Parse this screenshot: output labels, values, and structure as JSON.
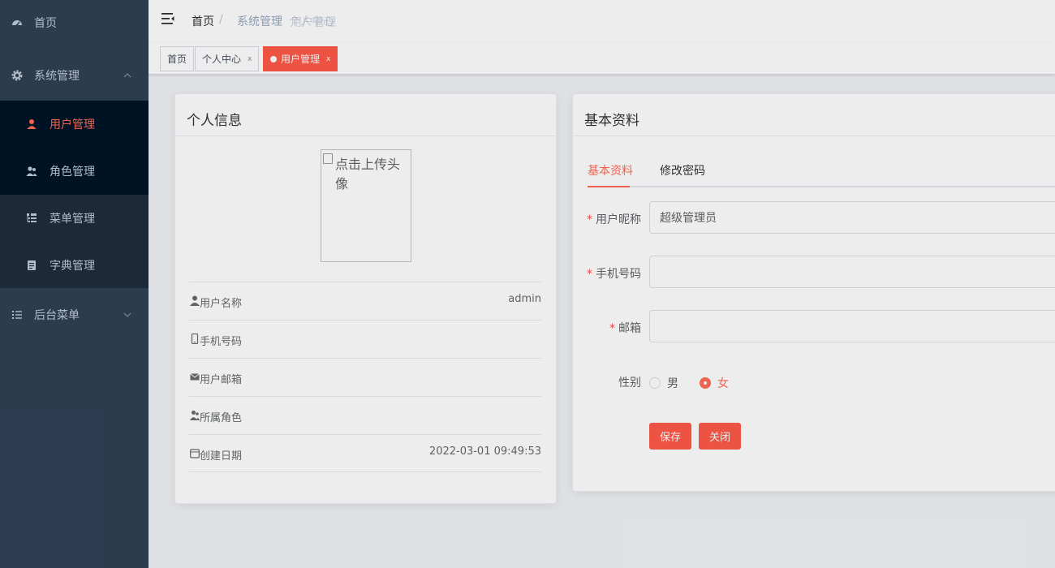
{
  "sidebar": {
    "items": [
      {
        "label": "首页",
        "icon": "dashboard-icon"
      },
      {
        "label": "系统管理",
        "icon": "gear-icon"
      },
      {
        "label": "后台菜单",
        "icon": "list-icon"
      }
    ],
    "sub_items": [
      {
        "label": "用户管理",
        "icon": "user-icon",
        "active": true
      },
      {
        "label": "角色管理",
        "icon": "peoples-icon"
      },
      {
        "label": "菜单管理",
        "icon": "tree-table-icon"
      },
      {
        "label": "字典管理",
        "icon": "dict-icon"
      }
    ]
  },
  "navbar": {
    "breadcrumb": [
      "首页",
      "系统管理",
      "个人中心",
      "用户管理"
    ],
    "separator": "/"
  },
  "tags": [
    {
      "label": "首页"
    },
    {
      "label": "个人中心",
      "close": "x"
    },
    {
      "label": "用户管理",
      "close": "x",
      "active": true
    }
  ],
  "profile": {
    "title": "个人信息",
    "avatar_text": "点击上传头像",
    "rows": [
      {
        "key": "用户名称",
        "value": "admin",
        "icon": "user-icon"
      },
      {
        "key": "手机号码",
        "value": "",
        "icon": "phone-icon"
      },
      {
        "key": "用户邮箱",
        "value": "",
        "icon": "email-icon"
      },
      {
        "key": "所属角色",
        "value": "",
        "icon": "peoples-icon"
      },
      {
        "key": "创建日期",
        "value": "2022-03-01 09:49:53",
        "icon": "date-icon"
      }
    ]
  },
  "basic": {
    "title": "基本资料",
    "tabs": [
      "基本资料",
      "修改密码"
    ],
    "fields": [
      {
        "label": "用户昵称",
        "value": "超级管理员",
        "required": true
      },
      {
        "label": "手机号码",
        "value": "",
        "required": true
      },
      {
        "label": "邮箱",
        "value": "",
        "required": true
      }
    ],
    "gender_label": "性别",
    "gender_options": [
      "男",
      "女"
    ],
    "gender_selected": "女",
    "save_label": "保存",
    "close_label": "关闭"
  },
  "colors": {
    "sidebar_bg": "#304156",
    "submenu_bg": "#1f2d3d",
    "accent": "#ff5a47"
  }
}
